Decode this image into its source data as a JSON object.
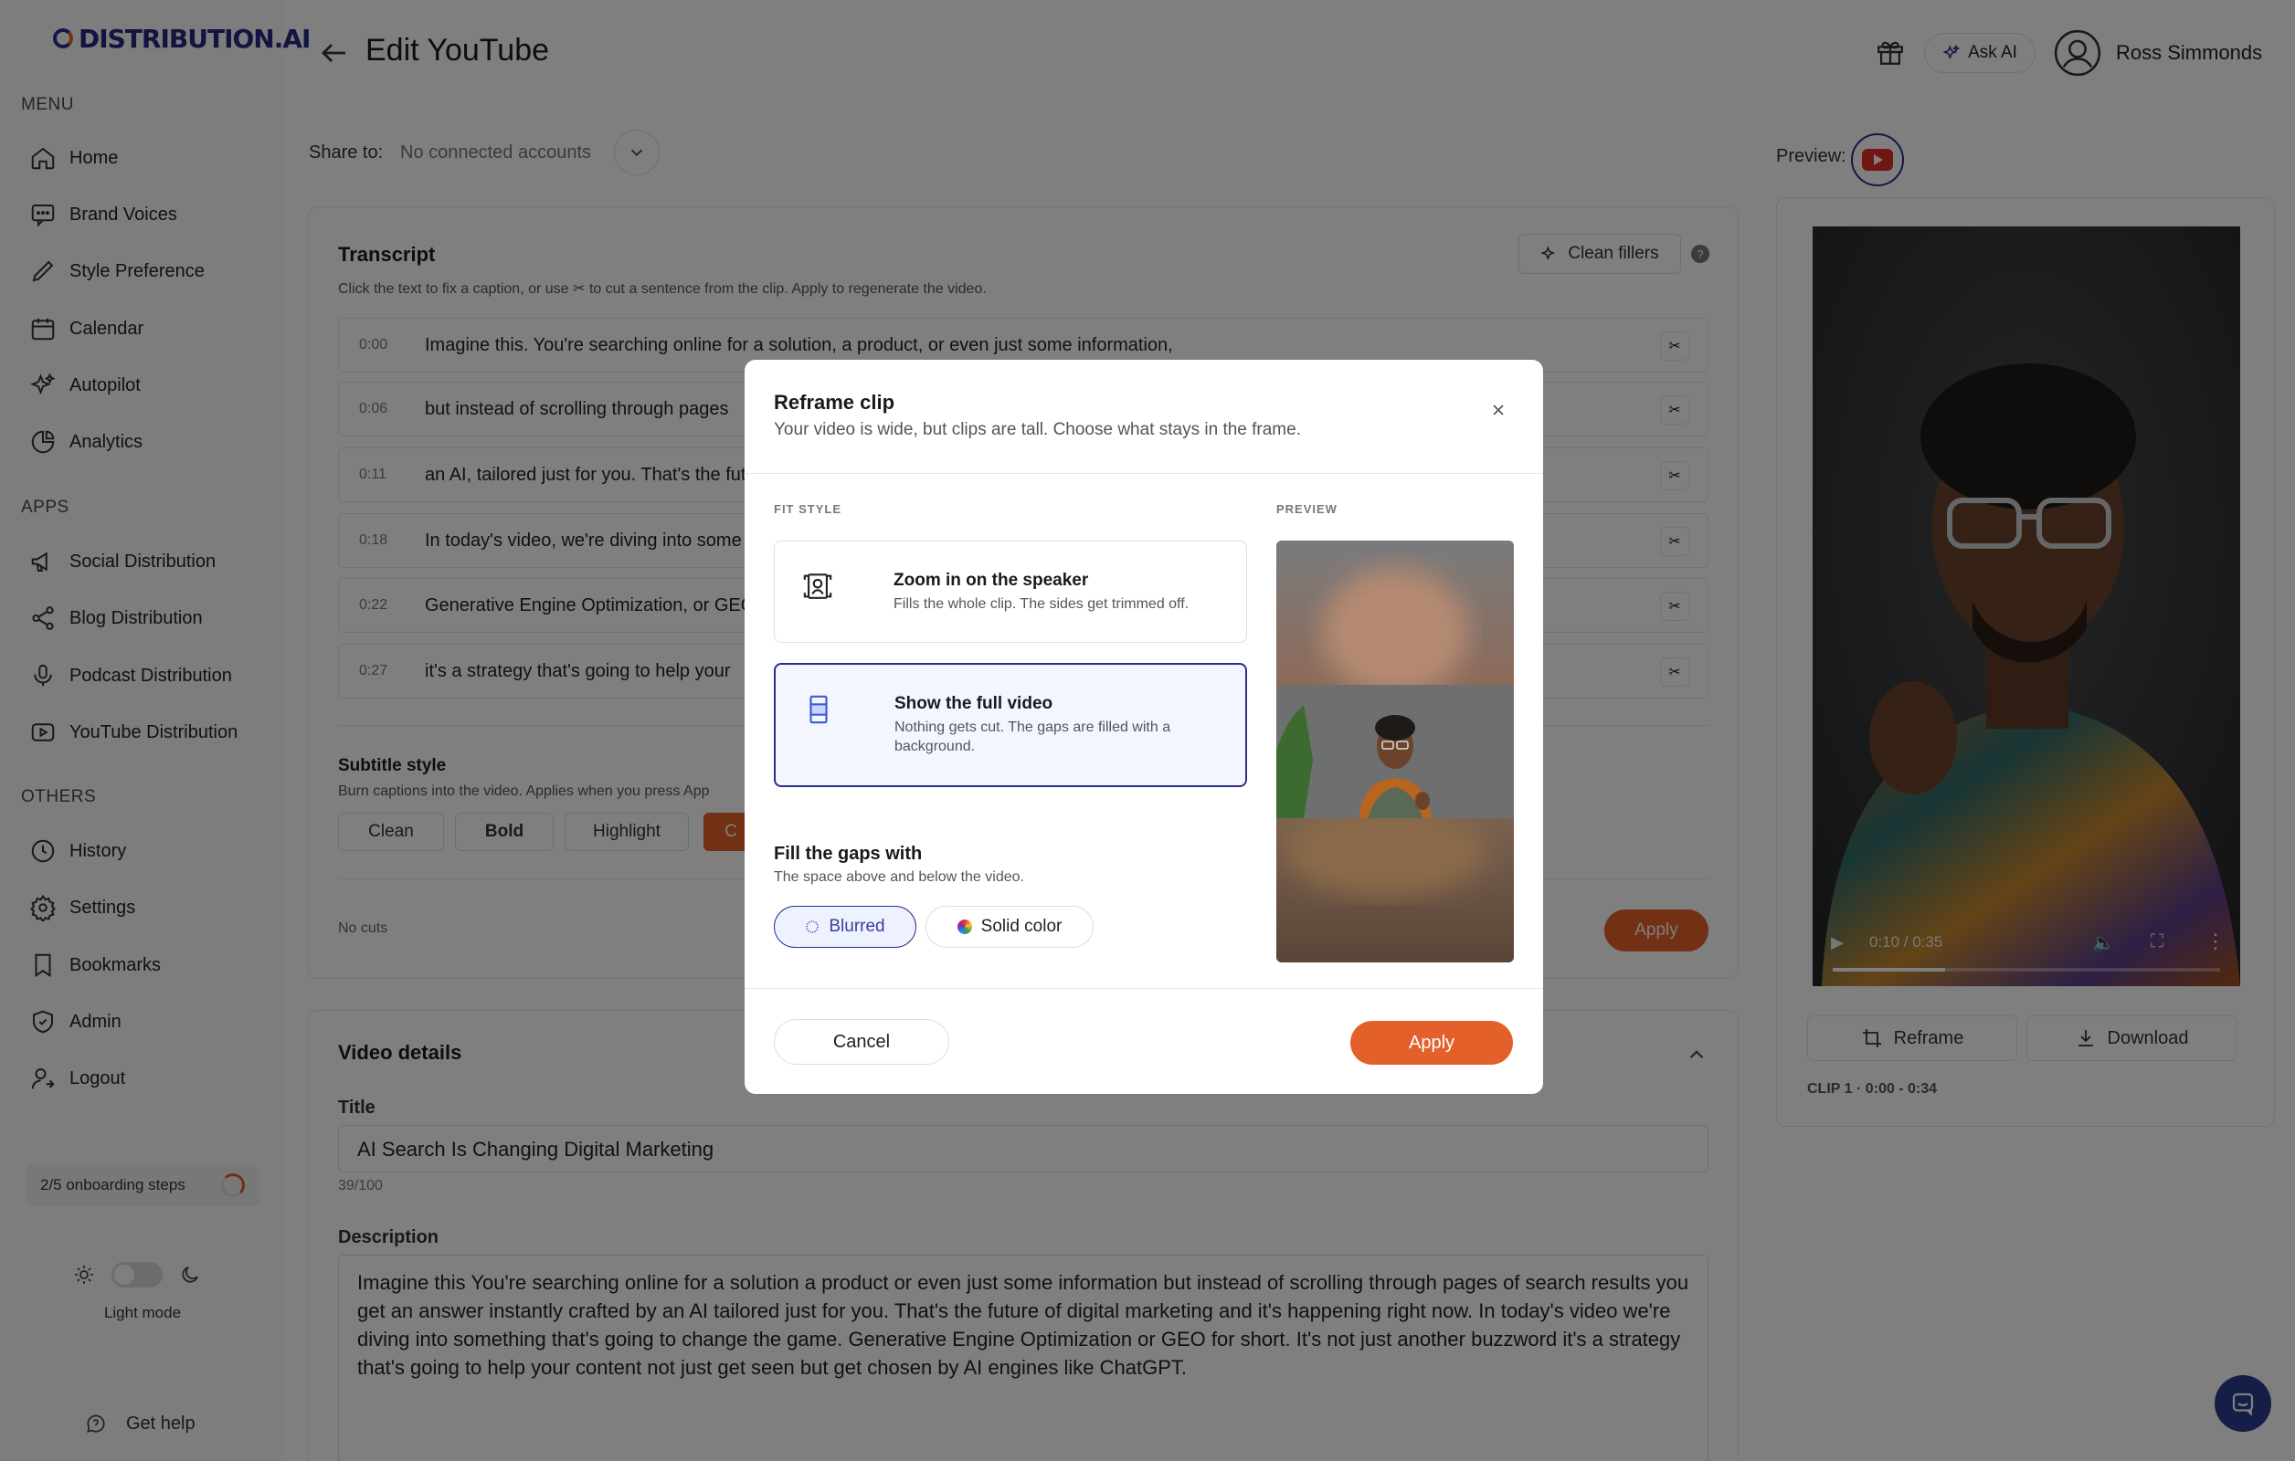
{
  "brand": {
    "logo_text": "DISTRIBUTION.AI"
  },
  "sidebar": {
    "menu_title": "MENU",
    "menu": [
      {
        "label": "Home",
        "icon": "home-icon"
      },
      {
        "label": "Brand Voices",
        "icon": "message-icon"
      },
      {
        "label": "Style Preference",
        "icon": "pen-icon"
      },
      {
        "label": "Calendar",
        "icon": "calendar-icon"
      },
      {
        "label": "Autopilot",
        "icon": "sparkles-icon"
      },
      {
        "label": "Analytics",
        "icon": "pie-chart-icon"
      }
    ],
    "apps_title": "APPS",
    "apps": [
      {
        "label": "Social Distribution",
        "icon": "megaphone-icon"
      },
      {
        "label": "Blog Distribution",
        "icon": "share-icon"
      },
      {
        "label": "Podcast Distribution",
        "icon": "microphone-icon"
      },
      {
        "label": "YouTube Distribution",
        "icon": "youtube-icon"
      }
    ],
    "others_title": "OTHERS",
    "others": [
      {
        "label": "History",
        "icon": "clock-icon"
      },
      {
        "label": "Settings",
        "icon": "gear-icon"
      },
      {
        "label": "Bookmarks",
        "icon": "bookmark-icon"
      },
      {
        "label": "Admin",
        "icon": "shield-icon"
      },
      {
        "label": "Logout",
        "icon": "logout-icon"
      }
    ],
    "onboarding": "2/5 onboarding steps",
    "mode_label": "Light mode",
    "help": "Get help"
  },
  "header": {
    "title": "Edit YouTube",
    "ask_ai": "Ask AI",
    "user_name": "Ross Simmonds"
  },
  "share": {
    "label": "Share to:",
    "value": "No connected accounts"
  },
  "transcript": {
    "title": "Transcript",
    "hint": "Click the text to fix a caption, or use ✂ to cut a sentence from the clip. Apply to regenerate the video.",
    "clean_fillers": "Clean fillers",
    "help": "?",
    "rows": [
      {
        "time": "0:00",
        "text": "Imagine this. You're searching online for a solution, a product, or even just some information,"
      },
      {
        "time": "0:06",
        "text": "but instead of scrolling through pages"
      },
      {
        "time": "0:11",
        "text": "an AI, tailored just for you. That's the fut"
      },
      {
        "time": "0:18",
        "text": "In today's video, we're diving into some"
      },
      {
        "time": "0:22",
        "text": "Generative Engine Optimization, or GEO"
      },
      {
        "time": "0:27",
        "text": "it's a strategy that's going to help your"
      }
    ],
    "subtitle_title": "Subtitle style",
    "subtitle_hint": "Burn captions into the video. Applies when you press App",
    "styles": [
      "Clean",
      "Bold",
      "Highlight",
      "C"
    ],
    "no_cuts": "No cuts",
    "apply": "Apply"
  },
  "details": {
    "title": "Video details",
    "title_label": "Title",
    "title_value": "AI Search Is Changing Digital Marketing",
    "title_count": "39/100",
    "desc_label": "Description",
    "desc_value": "Imagine this You're searching online for a solution a product or even just some information but instead of scrolling through pages of search results you get an answer instantly crafted by an AI tailored just for you. That's the future of digital marketing and it's happening right now. In today's video we're diving into something that's going to change the game. Generative Engine Optimization or GEO for short. It's not just another buzzword it's a strategy that's going to help your content not just get seen but get chosen by AI engines like ChatGPT."
  },
  "preview": {
    "label": "Preview:",
    "time": "0:10 / 0:35",
    "progress": 0.29,
    "reframe": "Reframe",
    "download": "Download",
    "clip_label": "CLIP 1 · 0:00 - 0:34"
  },
  "modal": {
    "title": "Reframe clip",
    "subtitle": "Your video is wide, but clips are tall. Choose what stays in the frame.",
    "fit_caption": "FIT STYLE",
    "preview_caption": "PREVIEW",
    "options": [
      {
        "title": "Zoom in on the speaker",
        "desc": "Fills the whole clip. The sides get trimmed off.",
        "selected": false
      },
      {
        "title": "Show the full video",
        "desc": "Nothing gets cut. The gaps are filled with a background.",
        "selected": true
      }
    ],
    "gap_title": "Fill the gaps with",
    "gap_sub": "The space above and below the video.",
    "fill_options": [
      {
        "label": "Blurred",
        "selected": true
      },
      {
        "label": "Solid color",
        "selected": false
      }
    ],
    "cancel": "Cancel",
    "apply": "Apply"
  },
  "colors": {
    "accent": "#e4602b",
    "brand": "#2b2e8f",
    "selected_bg": "#f4f6ff"
  }
}
